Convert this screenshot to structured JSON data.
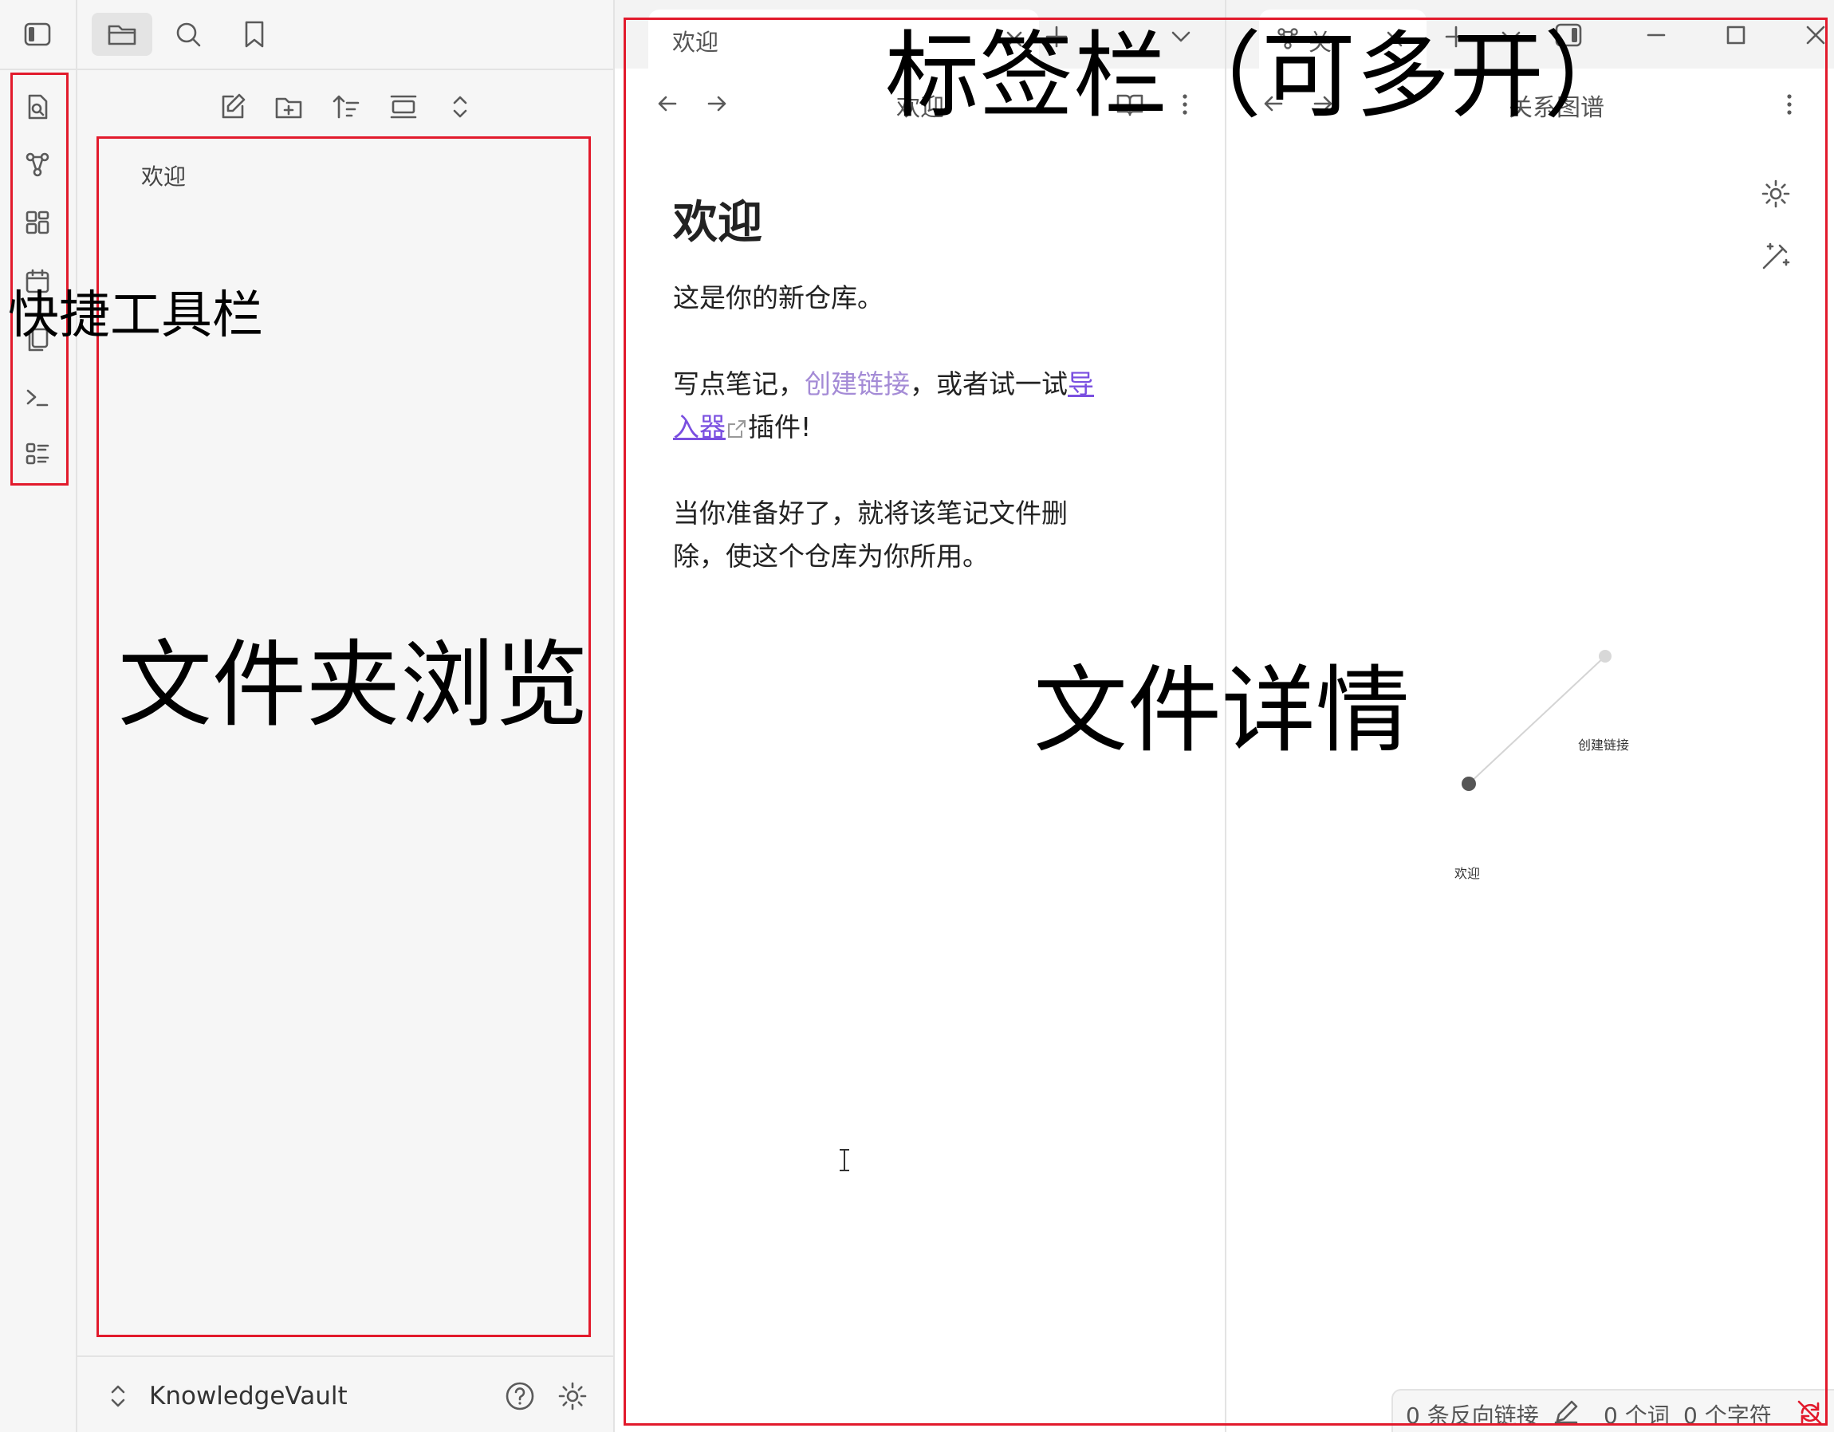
{
  "ribbon": {
    "items": [
      {
        "icon": "layout-sidebar-left-icon"
      },
      {
        "icon": "file-search-icon"
      },
      {
        "icon": "graph-icon"
      },
      {
        "icon": "canvas-grid-icon"
      },
      {
        "icon": "calendar-icon"
      },
      {
        "icon": "copy-icon"
      },
      {
        "icon": "terminal-icon"
      },
      {
        "icon": "outline-list-icon"
      }
    ]
  },
  "sidebar": {
    "tabs": [
      "folder-icon",
      "search-icon",
      "bookmark-icon"
    ],
    "toolbar": [
      "new-note-icon",
      "new-folder-icon",
      "sort-icon",
      "auto-reveal-icon",
      "collapse-all-icon"
    ],
    "files": [
      "欢迎"
    ],
    "vault_name": "KnowledgeVault"
  },
  "tabs": {
    "left": {
      "label": "欢迎"
    },
    "right": {
      "label": "关"
    }
  },
  "left_pane": {
    "view_title": "欢迎",
    "note": {
      "title": "欢迎",
      "p1": "这是你的新仓库。",
      "p2_a": "写点笔记，",
      "p2_link": "创建链接",
      "p2_b": "，或者试一试",
      "p2_ext_a": "导",
      "p2_ext_b": "入器",
      "p2_c": "插件!",
      "p3_line1": "当你准备好了，就将该笔记文件删",
      "p3_line2": "除，使这个仓库为你所用。"
    }
  },
  "right_pane": {
    "view_title": "关系图谱",
    "graph": {
      "nodes": [
        {
          "label": "创建链接",
          "state": "unresolved"
        },
        {
          "label": "欢迎",
          "state": "active"
        }
      ]
    }
  },
  "statusbar": {
    "backlinks": "0 条反向链接",
    "words": "0 个词",
    "chars": "0 个字符"
  },
  "annotations": {
    "ribbon": "快捷工具栏",
    "sidebar": "文件夹浏览",
    "tabbar": "标签栏（可多开）",
    "detail": "文件详情"
  },
  "colors": {
    "internal_link": "#a48bd6",
    "external_link": "#7a4fe0",
    "annotation_box": "#e21a2c"
  }
}
